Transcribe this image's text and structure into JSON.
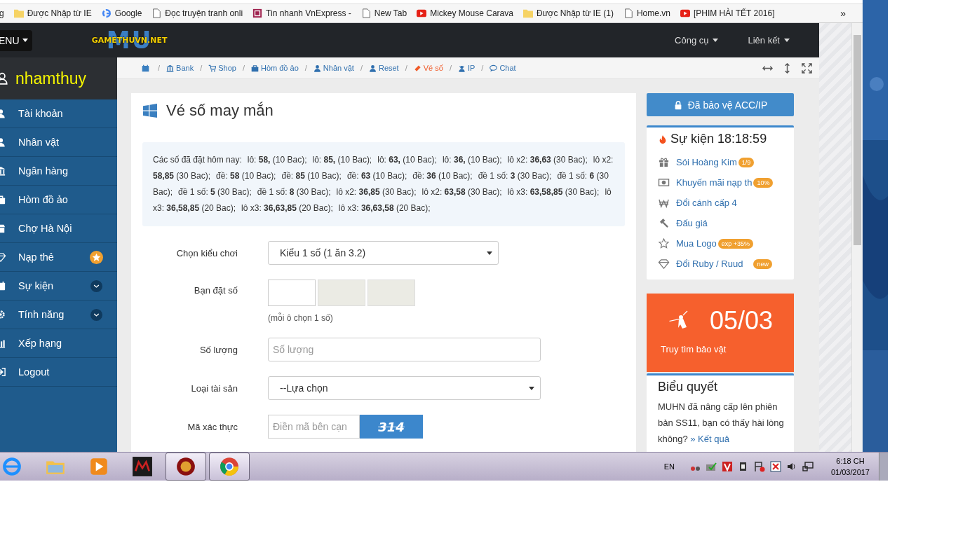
{
  "browser": {
    "bookmarks": [
      {
        "kind": "text",
        "label": "g"
      },
      {
        "kind": "folder",
        "label": "Được Nhập từ IE"
      },
      {
        "kind": "google",
        "label": "Google"
      },
      {
        "kind": "page",
        "label": "Đọc truyện tranh onli"
      },
      {
        "kind": "news",
        "label": "Tin nhanh VnExpress -"
      },
      {
        "kind": "page",
        "label": "New Tab"
      },
      {
        "kind": "video",
        "label": "Mickey Mouse Carava"
      },
      {
        "kind": "folder",
        "label": "Được Nhập từ IE (1)"
      },
      {
        "kind": "page",
        "label": "Home.vn"
      },
      {
        "kind": "video",
        "label": "[PHIM HÀI TẾT 2016]"
      }
    ],
    "more": "»"
  },
  "navbar": {
    "menu_button": "ENU",
    "logo_mark": "MU",
    "logo_text": "GAMETHUVN.NET",
    "links": [
      "Công cụ",
      "Liên kết"
    ]
  },
  "sidebar": {
    "username": "nhamthuy",
    "items": [
      {
        "label": "Tài khoản",
        "kind": "plain"
      },
      {
        "label": "Nhân vật",
        "kind": "plain"
      },
      {
        "label": "Ngân hàng",
        "kind": "plain"
      },
      {
        "label": "Hòm đồ ảo",
        "kind": "plain"
      },
      {
        "label": "Chợ Hà Nội",
        "kind": "plain"
      },
      {
        "label": "Nạp thẻ",
        "kind": "star"
      },
      {
        "label": "Sự kiện",
        "kind": "expand"
      },
      {
        "label": "Tính năng",
        "kind": "expand"
      },
      {
        "label": "Xếp hạng",
        "kind": "plain"
      },
      {
        "label": "Logout",
        "kind": "plain"
      }
    ]
  },
  "breadcrumb": {
    "separator": "/",
    "items": [
      {
        "label": "Bank",
        "selected": false
      },
      {
        "label": "Shop",
        "selected": false
      },
      {
        "label": "Hòm đồ ảo",
        "selected": false
      },
      {
        "label": "Nhân vật",
        "selected": false
      },
      {
        "label": "Reset",
        "selected": false
      },
      {
        "label": "Vé số",
        "selected": true
      },
      {
        "label": "IP",
        "selected": false
      },
      {
        "label": "Chat",
        "selected": false
      }
    ]
  },
  "main": {
    "title": "Vé số may mắn",
    "bets": {
      "intro": "Các số đã đặt hôm nay:",
      "entries": [
        "lô: **58,** (10 Bac);",
        "lô: **85,** (10 Bac);",
        "lô: **63,** (10 Bac);",
        "lô: **36,** (10 Bac);",
        "lô x2: **36,63** (30 Bac);",
        "lô x2: **58,85** (30 Bac);",
        "đề: **58** (10 Bac);",
        "đề: **85** (10 Bac);",
        "đề: **63** (10 Bac);",
        "đề: **36** (10 Bac);",
        "đề 1 số: **3** (30 Bac);",
        "đề 1 số: **6** (30 Bac);",
        "đề 1 số: **5** (30 Bac);",
        "đề 1 số: **8** (30 Bac);",
        "lô x2: **36,85** (30 Bac);",
        "lô x2: **63,58** (30 Bac);",
        "lô x3: **63,58,85** (30 Bac);",
        "lô x3: **36,58,85** (20 Bac);",
        "lô x3: **36,63,85** (20 Bac);",
        "lô x3: **36,63,58** (20 Bac);"
      ]
    },
    "form": [
      {
        "kind": "select",
        "label": "Chọn kiểu chơi",
        "value": "Kiểu 1 số (1 ăn 3.2)"
      },
      {
        "kind": "digits",
        "label": "Bạn đặt số",
        "boxes": [
          {
            "disabled": false
          },
          {
            "disabled": true
          },
          {
            "disabled": true
          }
        ],
        "hint": "(mỗi ô chọn 1 số)"
      },
      {
        "kind": "input",
        "label": "Số lượng",
        "placeholder": "Số lượng"
      },
      {
        "kind": "select",
        "label": "Loại tài sản",
        "value": "--Lựa chọn"
      },
      {
        "kind": "captcha",
        "label": "Mã xác thực",
        "placeholder": "Điền mã bên cạn",
        "code": "314"
      }
    ]
  },
  "right": {
    "protect_button": "Đã bảo vệ ACC/IP",
    "events": {
      "title": "Sự kiện 18:18:59",
      "items": [
        {
          "label": "Sói Hoàng Kim",
          "badge": "1/9"
        },
        {
          "label": "Khuyến mãi nạp th",
          "badge": "10%"
        },
        {
          "label": "Đổi cánh cấp 4"
        },
        {
          "label": "Đấu giá"
        },
        {
          "label": "Mua Logo",
          "badge": "exp +35%"
        },
        {
          "label": "Đổi Ruby / Ruud",
          "badge": "new"
        }
      ]
    },
    "treasure": {
      "date": "05/03",
      "label": "Truy tìm bảo vật"
    },
    "vote": {
      "title": "Biểu quyết",
      "text": "MUHN đã nâng cấp lên phiên bản SS11, bạn có thấy hài lòng không?",
      "link": "» Kết quả"
    }
  },
  "taskbar": {
    "apps": [
      {
        "selected": false
      },
      {
        "selected": false
      },
      {
        "selected": false
      },
      {
        "selected": false
      },
      {
        "selected": true
      },
      {
        "selected": true
      }
    ],
    "language": "EN",
    "time": "6:18 CH",
    "date": "01/03/2017"
  }
}
